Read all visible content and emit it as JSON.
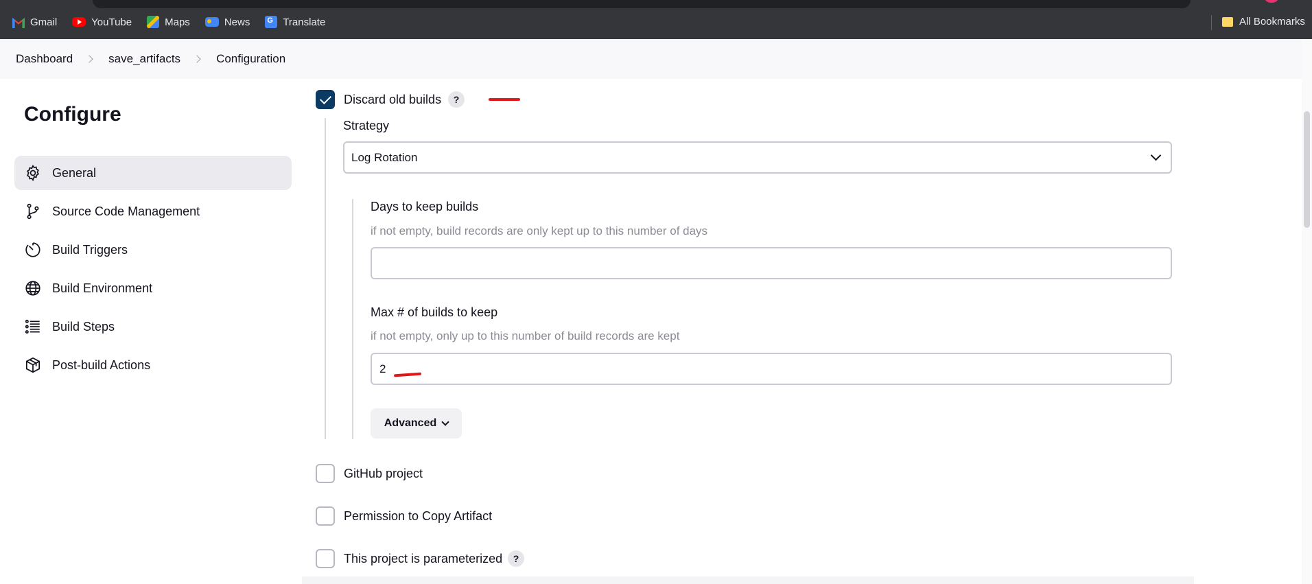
{
  "bookmarks": {
    "items": [
      {
        "label": "Gmail",
        "icon": "gmail-icon"
      },
      {
        "label": "YouTube",
        "icon": "youtube-icon"
      },
      {
        "label": "Maps",
        "icon": "maps-icon"
      },
      {
        "label": "News",
        "icon": "news-icon"
      },
      {
        "label": "Translate",
        "icon": "translate-icon"
      }
    ],
    "all_bookmarks": "All Bookmarks"
  },
  "breadcrumb": [
    "Dashboard",
    "save_artifacts",
    "Configuration"
  ],
  "sidebar": {
    "title": "Configure",
    "items": [
      {
        "label": "General",
        "icon": "gear-icon",
        "active": true
      },
      {
        "label": "Source Code Management",
        "icon": "branch-icon"
      },
      {
        "label": "Build Triggers",
        "icon": "timer-icon"
      },
      {
        "label": "Build Environment",
        "icon": "globe-icon"
      },
      {
        "label": "Build Steps",
        "icon": "list-icon"
      },
      {
        "label": "Post-build Actions",
        "icon": "package-icon"
      }
    ]
  },
  "form": {
    "discard_old_builds": {
      "label": "Discard old builds",
      "checked": true,
      "help": "?"
    },
    "strategy": {
      "label": "Strategy",
      "value": "Log Rotation"
    },
    "days_to_keep": {
      "label": "Days to keep builds",
      "description": "if not empty, build records are only kept up to this number of days",
      "value": ""
    },
    "max_builds": {
      "label": "Max # of builds to keep",
      "description": "if not empty, only up to this number of build records are kept",
      "value": "2"
    },
    "advanced_label": "Advanced",
    "github_project": {
      "label": "GitHub project",
      "checked": false
    },
    "copy_artifact": {
      "label": "Permission to Copy Artifact",
      "checked": false
    },
    "parameterized": {
      "label": "This project is parameterized",
      "checked": false,
      "help": "?"
    }
  },
  "colors": {
    "accent": "#0b3a63",
    "annotation": "#e01a1a",
    "active_nav": "#ebebef"
  }
}
